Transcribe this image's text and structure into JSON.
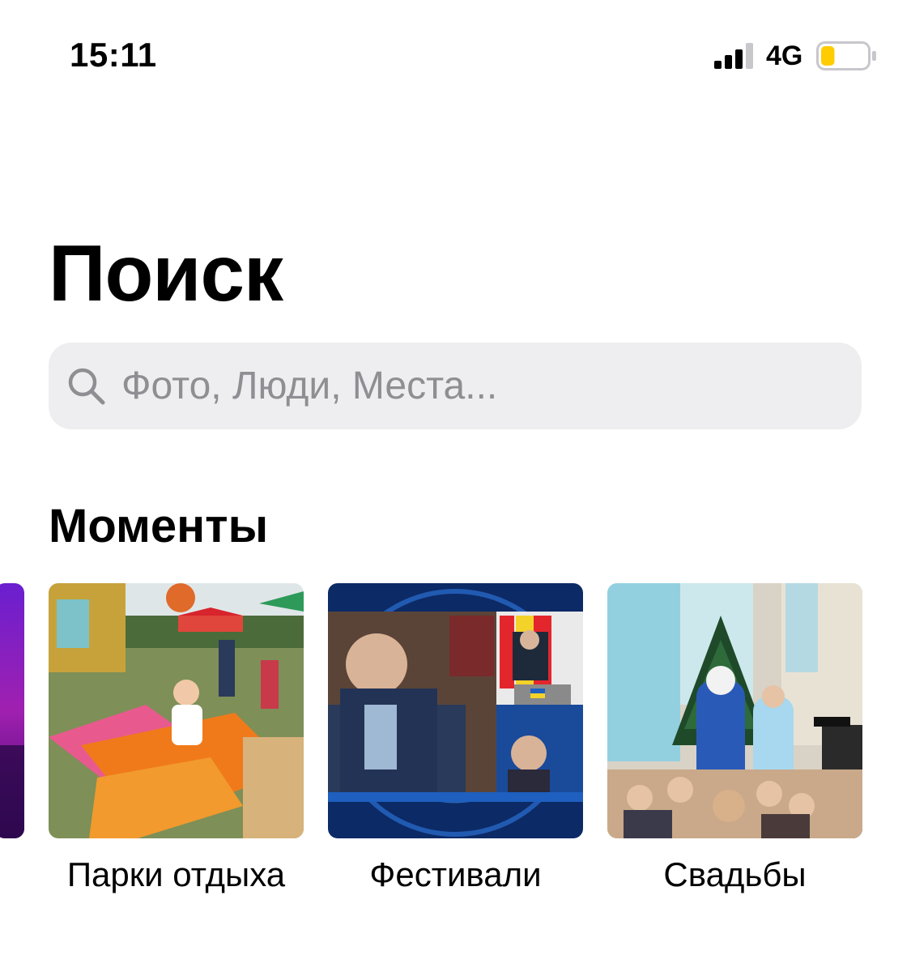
{
  "status_bar": {
    "time": "15:11",
    "network": "4G",
    "battery_level": 0.3,
    "battery_color": "#ffcc00"
  },
  "header": {
    "title": "Поиск"
  },
  "search": {
    "placeholder": "Фото, Люди, Места..."
  },
  "moments": {
    "title": "Моменты",
    "items": [
      {
        "label": "Парки отдыха",
        "image": "amusement-park-photo"
      },
      {
        "label": "Фестивали",
        "image": "tv-studio-photo"
      },
      {
        "label": "Свадьбы",
        "image": "new-year-party-photo"
      }
    ]
  }
}
